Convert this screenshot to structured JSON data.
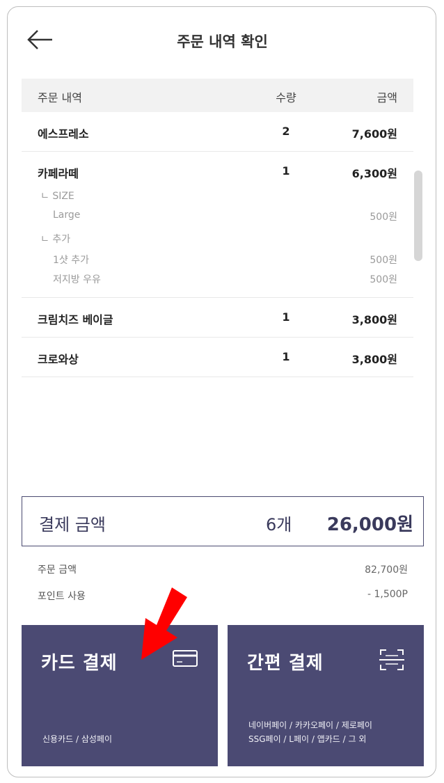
{
  "header": {
    "title": "주문 내역 확인"
  },
  "table": {
    "columns": {
      "name": "주문 내역",
      "qty": "수량",
      "price": "금액"
    },
    "rows": [
      {
        "name": "에스프레소",
        "qty": "2",
        "price": "7,600원"
      },
      {
        "name": "카페라떼",
        "qty": "1",
        "price": "6,300원",
        "options": [
          {
            "group": "ㄴ SIZE",
            "items": [
              {
                "name": "Large",
                "price": "500원"
              }
            ]
          },
          {
            "group": "ㄴ 추가",
            "items": [
              {
                "name": "1샷 추가",
                "price": "500원"
              },
              {
                "name": "저지방 우유",
                "price": "500원"
              }
            ]
          }
        ]
      },
      {
        "name": "크림치즈 베이글",
        "qty": "1",
        "price": "3,800원"
      },
      {
        "name": "크로와상",
        "qty": "1",
        "price": "3,800원"
      }
    ]
  },
  "total": {
    "label": "결제 금액",
    "count": "6개",
    "amount": "26,000원"
  },
  "summary": {
    "order_amount_label": "주문 금액",
    "order_amount_value": "82,700원",
    "point_label": "포인트 사용",
    "point_value": "- 1,500P"
  },
  "payment": {
    "card": {
      "title": "카드 결제",
      "desc": "신용카드 / 삼성페이",
      "icon": "credit-card-icon"
    },
    "easy": {
      "title": "간편 결제",
      "desc_line1": "네이버페이 / 카카오페이 / 제로페이",
      "desc_line2": "SSG페이 / L페이 / 앱카드 / 그 외",
      "icon": "qr-scan-icon"
    }
  },
  "colors": {
    "accent": "#4b4a73",
    "arrow": "#ff0000"
  }
}
